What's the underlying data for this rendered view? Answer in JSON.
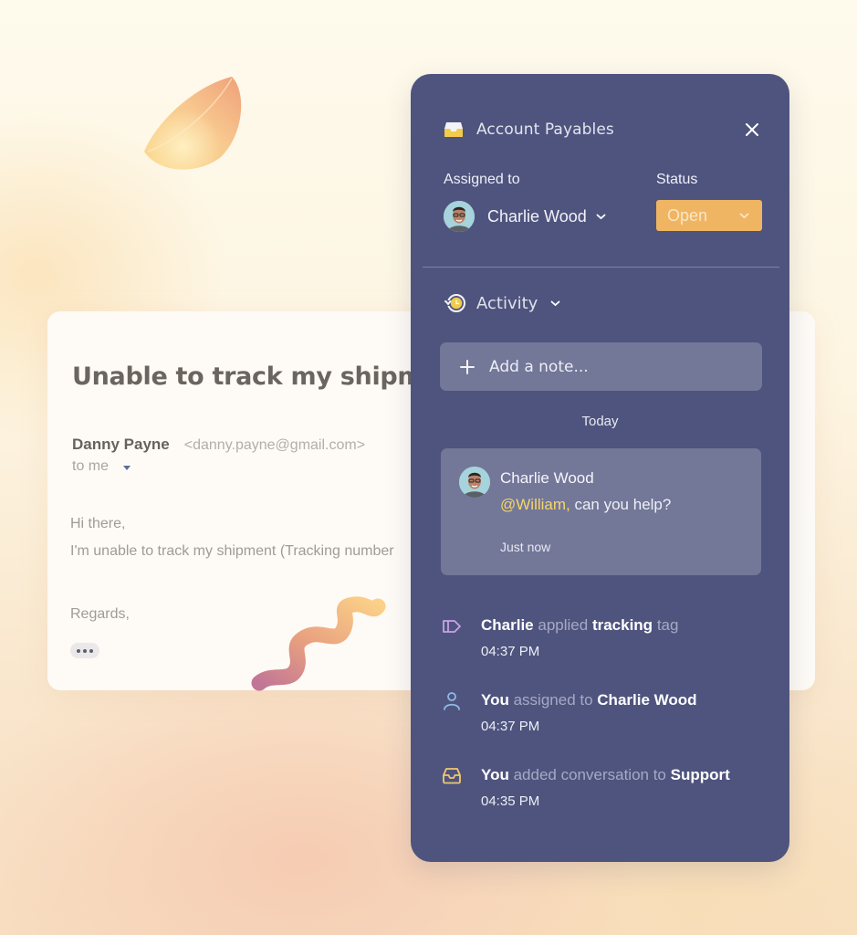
{
  "email": {
    "subject": "Unable to track my shipment",
    "from_name": "Danny Payne",
    "from_email": "<danny.payne@gmail.com>",
    "to_label": "to me",
    "greeting": "Hi there,",
    "body_line": "I'm unable to track my shipment (Tracking number",
    "signoff": "Regards,"
  },
  "panel": {
    "title": "Account Payables",
    "assigned_label": "Assigned to",
    "assignee": "Charlie Wood",
    "status_label": "Status",
    "status_value": "Open",
    "activity_label": "Activity",
    "add_note_placeholder": "Add a note...",
    "day_label": "Today",
    "comment": {
      "author": "Charlie Wood",
      "mention": "@William,",
      "text": " can you help?",
      "time": "Just now"
    },
    "events": [
      {
        "icon": "tag-icon",
        "actor": "Charlie",
        "verb": "applied",
        "object": "tracking",
        "suffix": "tag",
        "time": "04:37 PM"
      },
      {
        "icon": "user-icon",
        "actor": "You",
        "verb": "assigned to",
        "object": "Charlie Wood",
        "suffix": "",
        "time": "04:37 PM"
      },
      {
        "icon": "inbox-icon",
        "actor": "You",
        "verb": "added conversation to",
        "object": "Support",
        "suffix": "",
        "time": "04:35 PM"
      }
    ]
  },
  "colors": {
    "panel_bg": "#4f547e",
    "status_bg": "#f0b562",
    "mention": "#f5d66b",
    "tag_icon": "#c9a2e6",
    "user_icon": "#8fb8e6",
    "inbox_icon": "#f0c96e"
  }
}
